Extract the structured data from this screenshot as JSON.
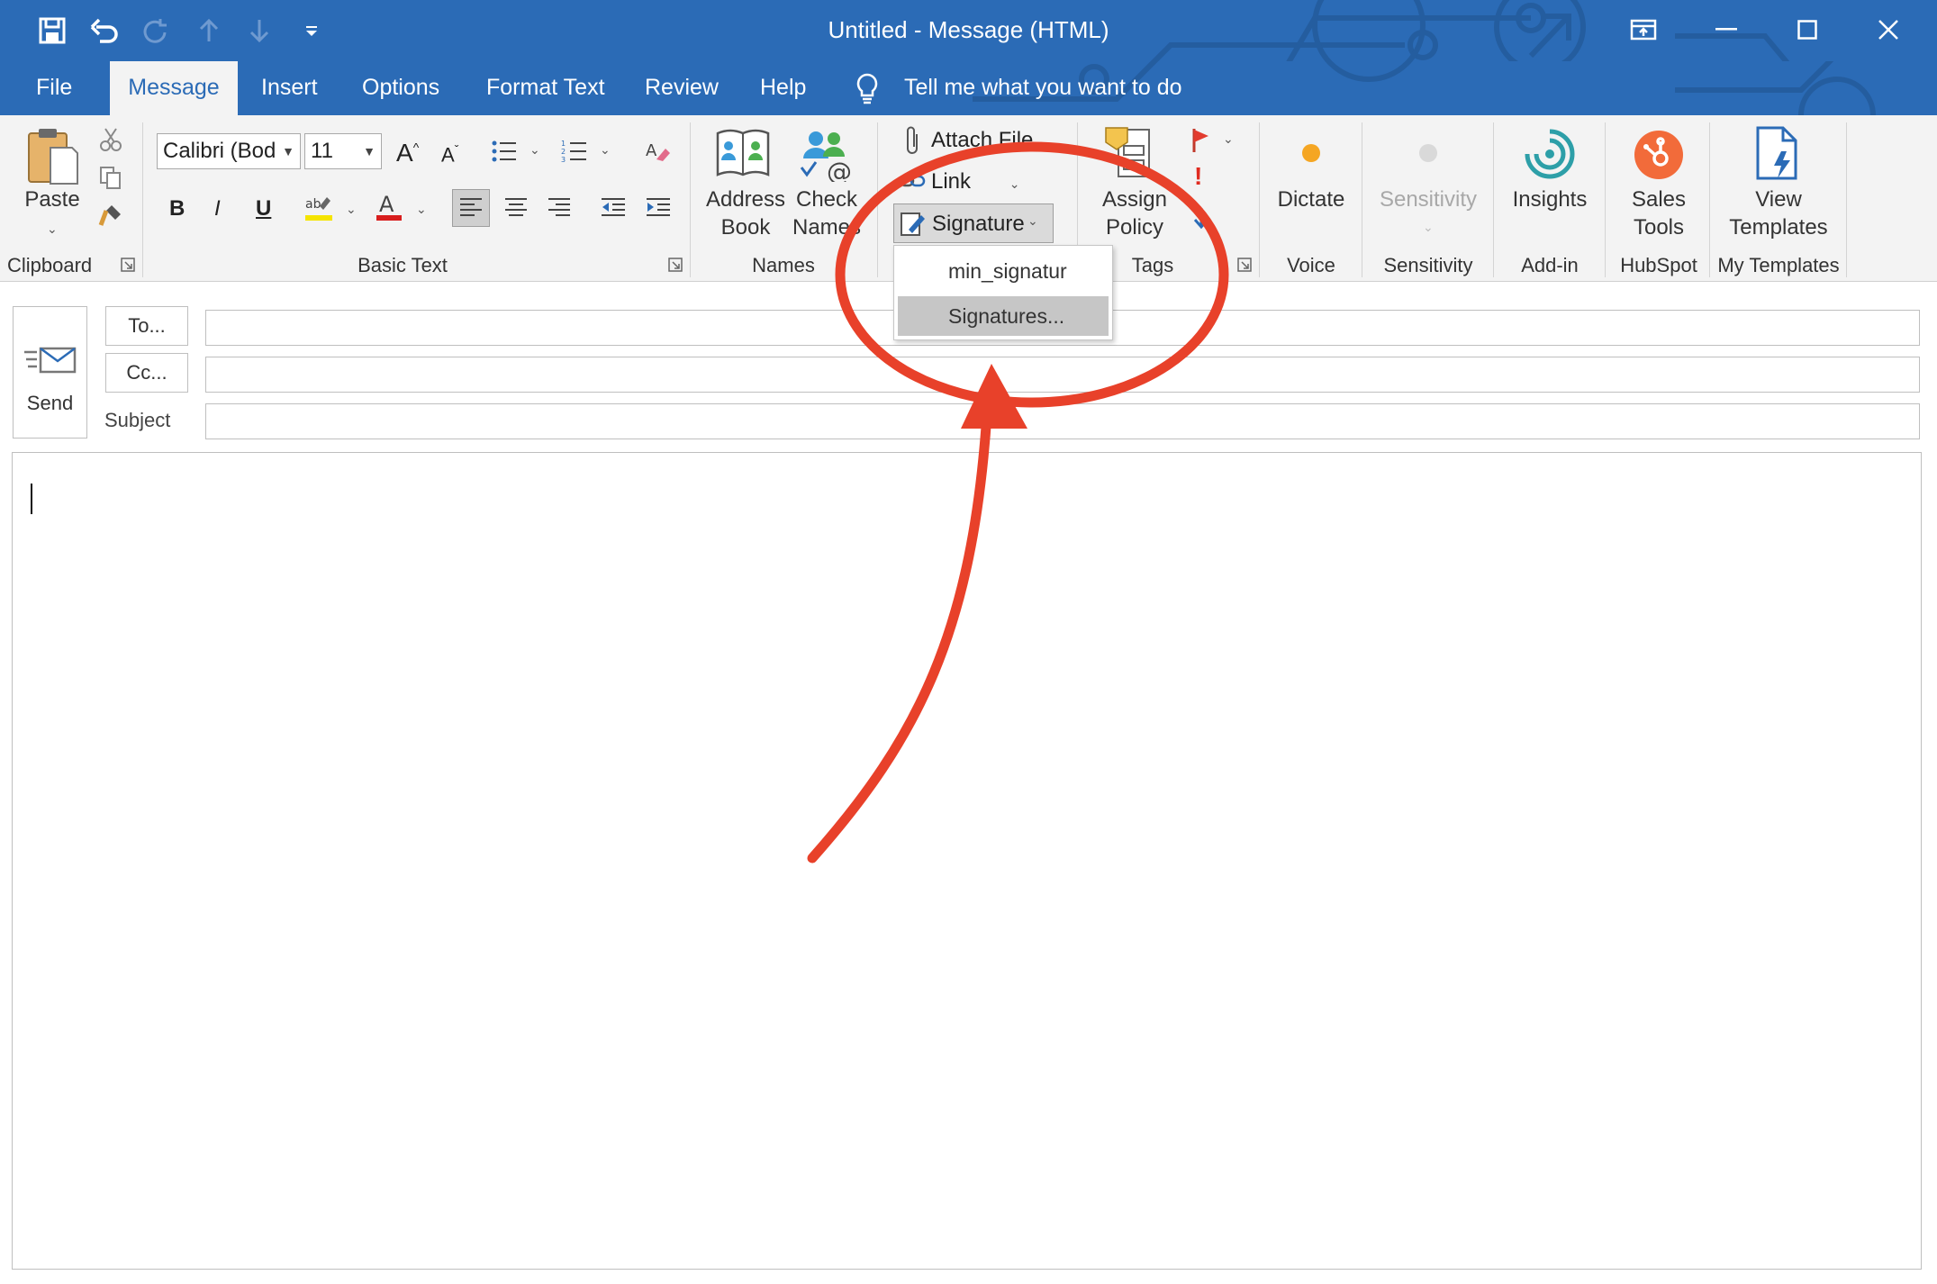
{
  "window": {
    "title": "Untitled  -  Message (HTML)"
  },
  "tabs": [
    {
      "label": "File"
    },
    {
      "label": "Message"
    },
    {
      "label": "Insert"
    },
    {
      "label": "Options"
    },
    {
      "label": "Format Text"
    },
    {
      "label": "Review"
    },
    {
      "label": "Help"
    }
  ],
  "tell_me": {
    "label": "Tell me what you want to do"
  },
  "ribbon": {
    "clipboard": {
      "paste": "Paste",
      "group": "Clipboard"
    },
    "basic_text": {
      "font": "Calibri (Bod",
      "size": "11",
      "bold": "B",
      "italic": "I",
      "underline": "U",
      "group": "Basic Text"
    },
    "names": {
      "address_book_1": "Address",
      "address_book_2": "Book",
      "check_names_1": "Check",
      "check_names_2": "Names",
      "group": "Names"
    },
    "include": {
      "attach_file": "Attach File",
      "link": "Link",
      "signature": "Signature"
    },
    "tags": {
      "assign_policy_1": "Assign",
      "assign_policy_2": "Policy",
      "group": "Tags"
    },
    "voice": {
      "dictate": "Dictate",
      "group": "Voice"
    },
    "sensitivity": {
      "button": "Sensitivity",
      "group": "Sensitivity"
    },
    "addin": {
      "insights": "Insights",
      "group": "Add-in"
    },
    "hubspot": {
      "sales_1": "Sales",
      "sales_2": "Tools",
      "group": "HubSpot"
    },
    "templates": {
      "view_1": "View",
      "view_2": "Templates",
      "group": "My Templates"
    }
  },
  "signature_menu": {
    "items": [
      {
        "label": "min_signatur"
      },
      {
        "label": "Signatures..."
      }
    ]
  },
  "compose": {
    "send": "Send",
    "to": "To...",
    "cc": "Cc...",
    "subject": "Subject",
    "to_value": "",
    "cc_value": "",
    "subject_value": ""
  },
  "colors": {
    "title_bar": "#2b6bb6",
    "ribbon": "#f3f3f3",
    "annotation": "#e8412a"
  }
}
